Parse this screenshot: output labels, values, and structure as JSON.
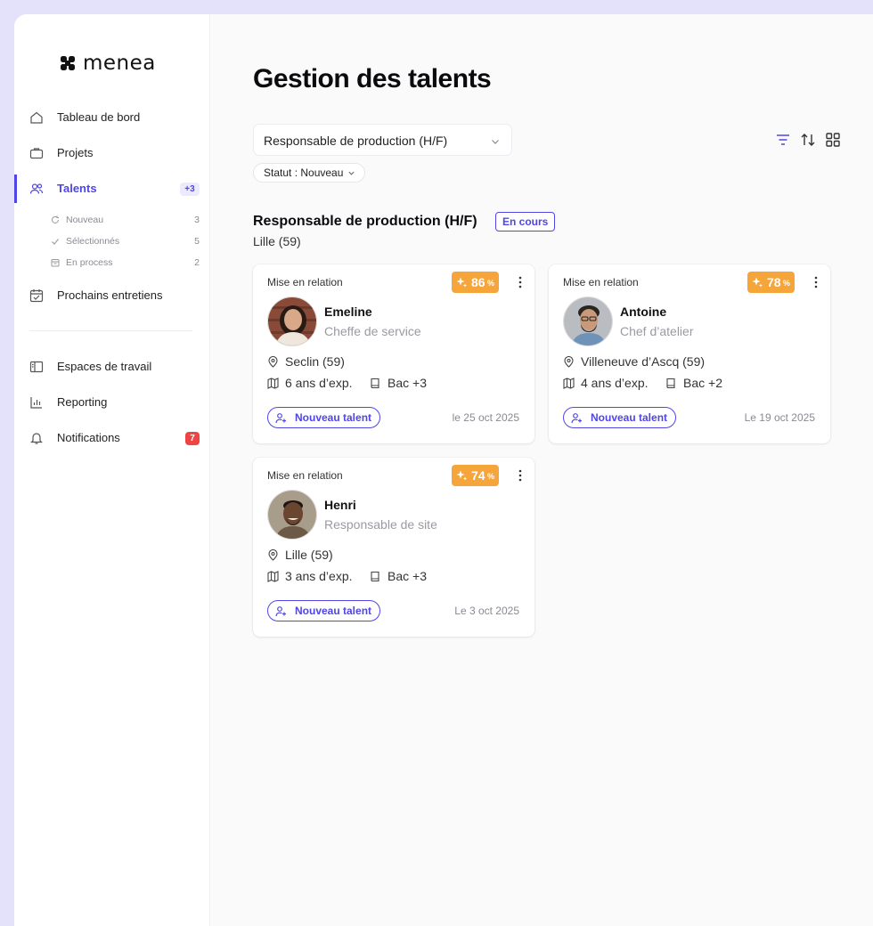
{
  "brand": {
    "name": "menea"
  },
  "sidebar": {
    "items": [
      {
        "label": "Tableau de bord",
        "icon": "home-icon"
      },
      {
        "label": "Projets",
        "icon": "briefcase-icon"
      },
      {
        "label": "Talents",
        "icon": "users-icon",
        "badge": "+3",
        "active": true
      },
      {
        "label": "Prochains entretiens",
        "icon": "calendar-icon"
      },
      {
        "label": "Espaces de travail",
        "icon": "sidebar-panel-icon"
      },
      {
        "label": "Reporting",
        "icon": "bar-chart-icon"
      },
      {
        "label": "Notifications",
        "icon": "bell-icon",
        "badge": "7"
      }
    ],
    "subitems": [
      {
        "label": "Nouveau",
        "count": "3",
        "icon": "refresh-icon"
      },
      {
        "label": "Sélectionnés",
        "count": "5",
        "icon": "check-icon"
      },
      {
        "label": "En process",
        "count": "2",
        "icon": "calendar-small-icon"
      }
    ]
  },
  "main": {
    "title": "Gestion des talents",
    "job_select": {
      "value": "Responsable de production (H/F)"
    },
    "status_filter": {
      "label": "Statut : Nouveau"
    },
    "section": {
      "title": "Responsable de production (H/F)",
      "badge": "En cours",
      "location": "Lille (59)"
    },
    "cards": [
      {
        "relation": "Mise en relation",
        "score": "86",
        "score_unit": "%",
        "name": "Emeline",
        "role": "Cheffe de service",
        "location": "Seclin (59)",
        "experience": "6 ans d’exp.",
        "education": "Bac +3",
        "tag": "Nouveau talent",
        "date": "le 25 oct 2025"
      },
      {
        "relation": "Mise en relation",
        "score": "78",
        "score_unit": "%",
        "name": "Antoine",
        "role": "Chef d’atelier",
        "location": "Villeneuve d’Ascq (59)",
        "experience": "4 ans d’exp.",
        "education": "Bac +2",
        "tag": "Nouveau talent",
        "date": "Le 19 oct 2025"
      },
      {
        "relation": "Mise en relation",
        "score": "74",
        "score_unit": "%",
        "name": "Henri",
        "role": "Responsable de site",
        "location": "Lille (59)",
        "experience": "3 ans d’exp.",
        "education": "Bac +3",
        "tag": "Nouveau talent",
        "date": "Le 3 oct 2025"
      }
    ]
  },
  "colors": {
    "accent": "#4f46e5",
    "score": "#f6a53a",
    "alert": "#ef4444"
  }
}
